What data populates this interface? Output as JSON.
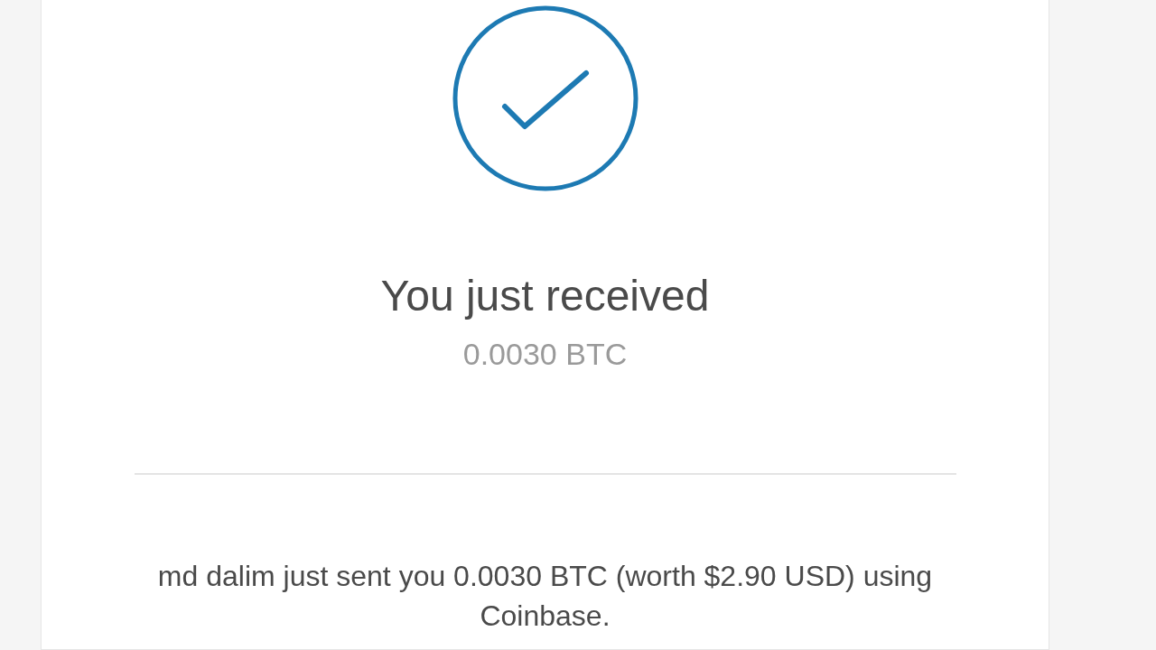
{
  "title": "You just received",
  "amount": "0.0030 BTC",
  "message": "md dalim just sent you 0.0030 BTC (worth $2.90 USD) using Coinbase."
}
